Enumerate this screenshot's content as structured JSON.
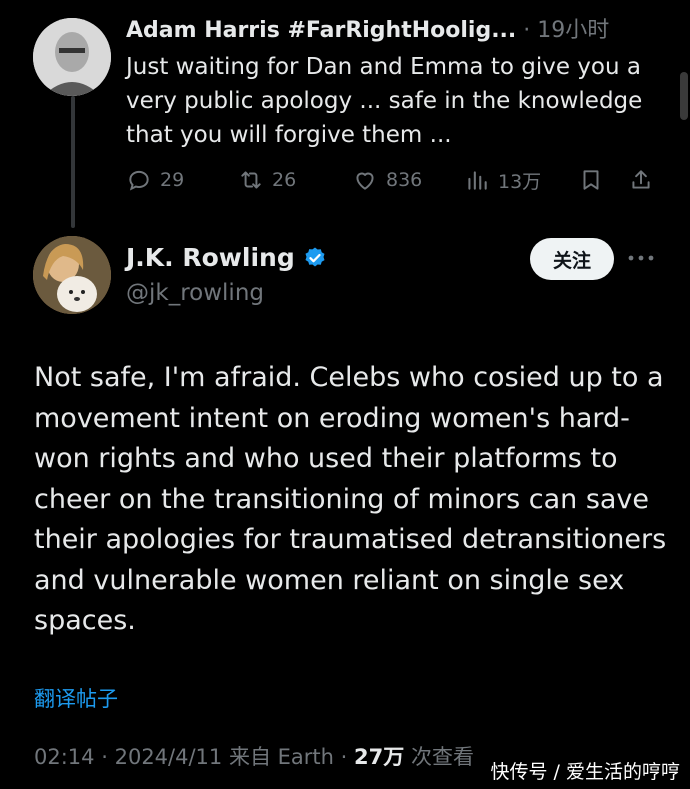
{
  "reply": {
    "name": "Adam Harris #FarRightHoolig...",
    "dot": "·",
    "time": "19小时",
    "text": "Just waiting for Dan and Emma to give you a very public apology ... safe in the knowledge that you will forgive them ...",
    "stats": {
      "replies": "29",
      "retweets": "26",
      "likes": "836",
      "views": "13万"
    }
  },
  "tweet": {
    "author_name": "J.K. Rowling",
    "handle": "@jk_rowling",
    "follow_label": "关注",
    "text": "Not safe, I'm afraid. Celebs who cosied up to a movement intent on eroding women's hard-won rights and who used their platforms to cheer on the transitioning of minors can save their apologies for traumatised detransitioners and vulnerable women reliant on single sex spaces.",
    "translate_label": "翻译帖子",
    "time": "02:14",
    "date": "2024/4/11",
    "source": "来自 Earth",
    "views": "27万",
    "views_label": "次查看",
    "sep": "·"
  },
  "watermark": "快传号 / 爱生活的哼哼",
  "colors": {
    "background": "#000000",
    "accent": "#1d9bf0",
    "muted": "#71767b",
    "text": "#e7e9ea"
  }
}
